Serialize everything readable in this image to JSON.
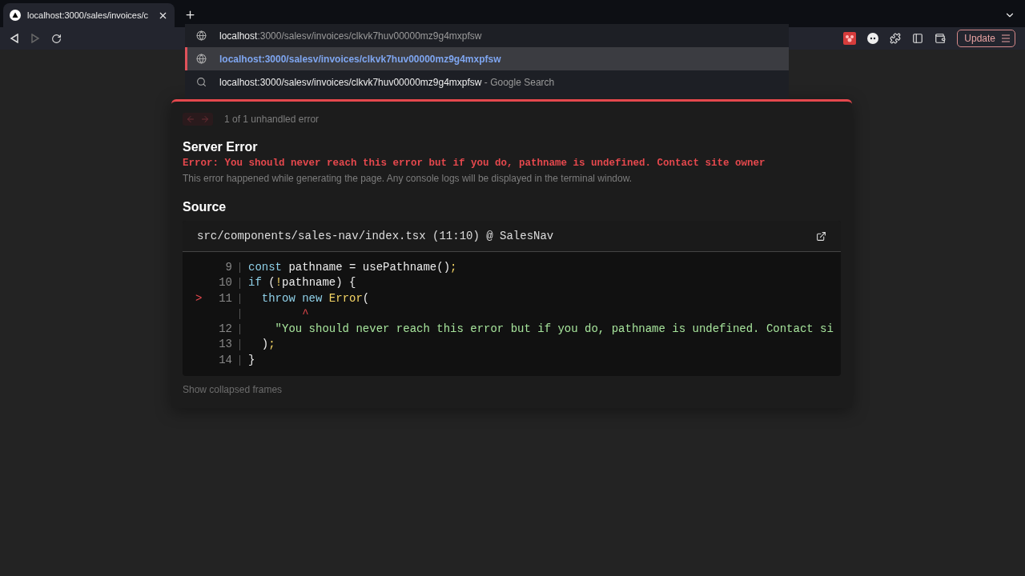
{
  "browser": {
    "tab": {
      "title": "localhost:3000/sales/invoices/c",
      "selected": true
    },
    "nav": {
      "forward_disabled": true
    },
    "omnibox": {
      "host": "localhost",
      "path": ":3000/salesv/invoices/clkvk7huv00000mz9g4mxpfsw",
      "suggestions": [
        {
          "kind": "url",
          "text": "localhost:3000/salesv/invoices/clkvk7huv00000mz9g4mxpfsw",
          "selected": true
        },
        {
          "kind": "search",
          "text": "localhost:3000/salesv/invoices/clkvk7huv00000mz9g4mxpfsw",
          "suffix": "- Google Search",
          "selected": false
        }
      ]
    },
    "update_button": "Update"
  },
  "overlay": {
    "pager": "1 of 1 unhandled error",
    "title": "Server Error",
    "message": "Error: You should never reach this error but if you do, pathname is undefined. Contact site owner",
    "description": "This error happened while generating the page. Any console logs will be displayed in the terminal window.",
    "source_title": "Source",
    "file": "src/components/sales-nav/index.tsx (11:10) @ SalesNav",
    "lines": [
      {
        "number": "9",
        "tokens": [
          {
            "kind": "keyword",
            "text": "const"
          },
          {
            "kind": "plain",
            "text": " pathname = usePathname()"
          },
          {
            "kind": "punct",
            "text": ";"
          }
        ]
      },
      {
        "number": "10",
        "tokens": [
          {
            "kind": "keyword",
            "text": "if"
          },
          {
            "kind": "plain",
            "text": " ("
          },
          {
            "kind": "punct",
            "text": "!"
          },
          {
            "kind": "plain",
            "text": "pathname) {"
          }
        ]
      },
      {
        "number": "11",
        "marker": ">",
        "tokens": [
          {
            "kind": "keyword",
            "text": "  throw new"
          },
          {
            "kind": "func",
            "text": " Error"
          },
          {
            "kind": "plain",
            "text": "("
          }
        ]
      },
      {
        "tokens": [
          {
            "kind": "caret",
            "text": "        ^"
          }
        ]
      },
      {
        "number": "12",
        "tokens": [
          {
            "kind": "string",
            "text": "    \"You should never reach this error but if you do, pathname is undefined. Contact si"
          }
        ]
      },
      {
        "number": "13",
        "tokens": [
          {
            "kind": "plain",
            "text": "  )"
          },
          {
            "kind": "punct",
            "text": ";"
          }
        ]
      },
      {
        "number": "14",
        "tokens": [
          {
            "kind": "plain",
            "text": "}"
          }
        ]
      }
    ],
    "collapsed": "Show collapsed frames"
  }
}
